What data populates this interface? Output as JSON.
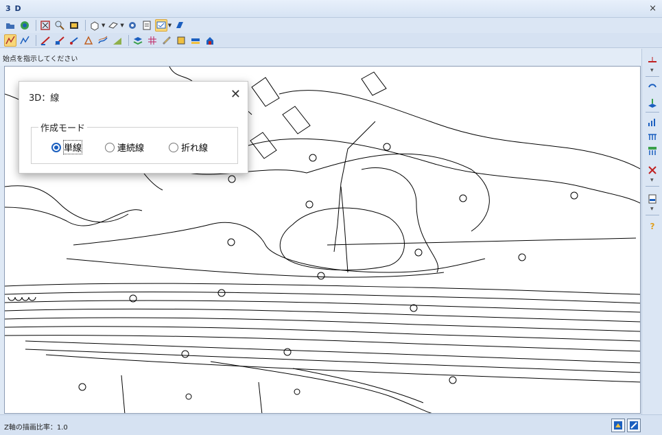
{
  "window": {
    "title": "3 D",
    "close_glyph": "×"
  },
  "toolbar1": {
    "icons": [
      "open-icon",
      "sync-icon",
      "zoom-all-icon",
      "zoom-icon",
      "zoom-window-icon",
      "view-box-icon",
      "view-plane-icon",
      "settings-gear-icon",
      "clipboard-icon",
      "select-mode-icon",
      "layer-icon"
    ]
  },
  "toolbar2": {
    "icons": [
      "line-draw-icon",
      "line-edit-icon",
      "polyline-icon",
      "surface-icon",
      "point-icon",
      "triangle-icon",
      "contour-icon",
      "slope-icon",
      "layer-stack-icon",
      "grid-icon",
      "measure-icon",
      "fill-icon",
      "export-icon"
    ]
  },
  "prompt": "始点を指示してください",
  "dialog": {
    "title": "3D：線",
    "close_glyph": "✕",
    "group_label": "作成モード",
    "options": [
      {
        "label": "単線",
        "selected": true
      },
      {
        "label": "連続線",
        "selected": false
      },
      {
        "label": "折れ線",
        "selected": false
      }
    ]
  },
  "rightbar": {
    "icons": [
      "baseline-icon",
      "rotate-icon",
      "layer-up-icon",
      "bar-chart-icon",
      "tin-icon",
      "tin-grid-icon",
      "cut-icon",
      "dwg-file-icon",
      "help-icon"
    ]
  },
  "statusbar": {
    "z_ratio_label": "Z軸の描画比率：1.0"
  },
  "colors": {
    "accent": "#1b5fbf",
    "active_button": "#f8d778",
    "chrome": "#dbe6f4"
  }
}
